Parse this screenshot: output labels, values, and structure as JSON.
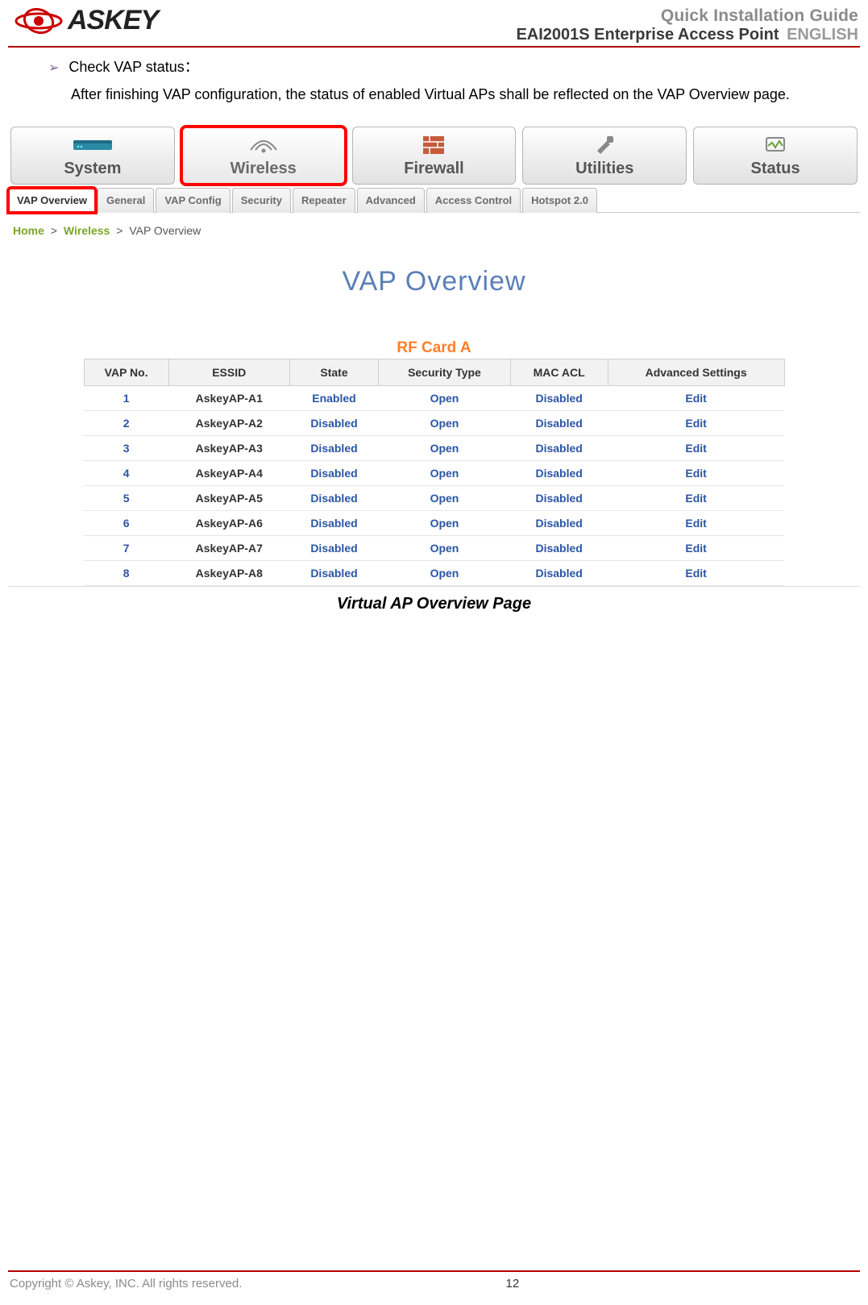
{
  "header": {
    "brand": "ASKEY",
    "line1": "Quick Installation Guide",
    "line2_product": "EAI2001S Enterprise Access Point",
    "line2_lang": "ENGLISH"
  },
  "body": {
    "bullet_title": "Check VAP status：",
    "bullet_para": "After finishing VAP configuration, the status of enabled Virtual APs shall be reflected on the VAP Overview page."
  },
  "screenshot": {
    "main_tabs": [
      "System",
      "Wireless",
      "Firewall",
      "Utilities",
      "Status"
    ],
    "main_tab_active_index": 1,
    "sub_tabs": [
      "VAP Overview",
      "General",
      "VAP Config",
      "Security",
      "Repeater",
      "Advanced",
      "Access Control",
      "Hotspot 2.0"
    ],
    "sub_tab_active_index": 0,
    "crumbs": {
      "home": "Home",
      "section": "Wireless",
      "leaf": "VAP Overview"
    },
    "panel_title": "VAP Overview",
    "rf_title": "RF Card A",
    "table": {
      "headers": [
        "VAP No.",
        "ESSID",
        "State",
        "Security Type",
        "MAC ACL",
        "Advanced Settings"
      ],
      "rows": [
        {
          "no": "1",
          "essid": "AskeyAP-A1",
          "state": "Enabled",
          "sec": "Open",
          "acl": "Disabled",
          "adv": "Edit"
        },
        {
          "no": "2",
          "essid": "AskeyAP-A2",
          "state": "Disabled",
          "sec": "Open",
          "acl": "Disabled",
          "adv": "Edit"
        },
        {
          "no": "3",
          "essid": "AskeyAP-A3",
          "state": "Disabled",
          "sec": "Open",
          "acl": "Disabled",
          "adv": "Edit"
        },
        {
          "no": "4",
          "essid": "AskeyAP-A4",
          "state": "Disabled",
          "sec": "Open",
          "acl": "Disabled",
          "adv": "Edit"
        },
        {
          "no": "5",
          "essid": "AskeyAP-A5",
          "state": "Disabled",
          "sec": "Open",
          "acl": "Disabled",
          "adv": "Edit"
        },
        {
          "no": "6",
          "essid": "AskeyAP-A6",
          "state": "Disabled",
          "sec": "Open",
          "acl": "Disabled",
          "adv": "Edit"
        },
        {
          "no": "7",
          "essid": "AskeyAP-A7",
          "state": "Disabled",
          "sec": "Open",
          "acl": "Disabled",
          "adv": "Edit"
        },
        {
          "no": "8",
          "essid": "AskeyAP-A8",
          "state": "Disabled",
          "sec": "Open",
          "acl": "Disabled",
          "adv": "Edit"
        }
      ]
    },
    "caption": "Virtual AP Overview Page"
  },
  "footer": {
    "copyright": "Copyright © Askey, INC. All rights reserved.",
    "page_number": "12"
  }
}
